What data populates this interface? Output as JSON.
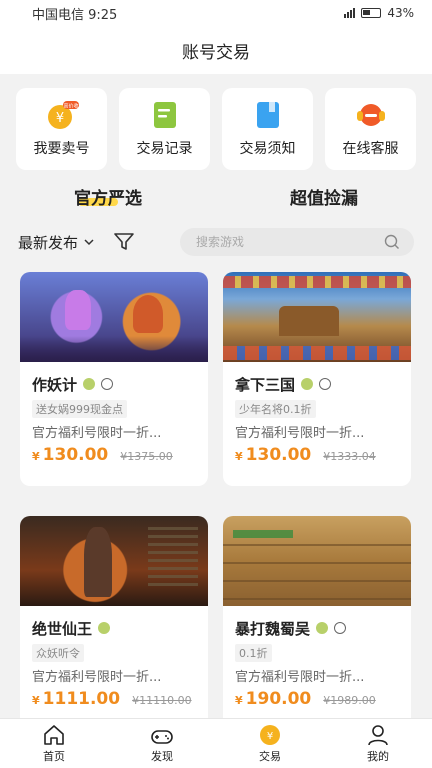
{
  "status": {
    "carrier_time": "中国电信 9:25",
    "battery": "43%"
  },
  "title": "账号交易",
  "quick_actions": [
    {
      "label": "我要卖号",
      "badge": "高价收"
    },
    {
      "label": "交易记录"
    },
    {
      "label": "交易须知"
    },
    {
      "label": "在线客服"
    }
  ],
  "tabs": [
    {
      "label": "官方严选",
      "active": true
    },
    {
      "label": "超值捡漏",
      "active": false
    }
  ],
  "filter": {
    "sort_label": "最新发布",
    "search_placeholder": "搜索游戏"
  },
  "cards": [
    {
      "name": "作妖计",
      "tag": "送女娲999现金点",
      "desc": "官方福利号限时一折...",
      "price": "130.00",
      "original": "¥1375.00",
      "platforms": [
        "android",
        "ios"
      ]
    },
    {
      "name": "拿下三国",
      "tag": "少年名将0.1折",
      "desc": "官方福利号限时一折...",
      "price": "130.00",
      "original": "¥1333.04",
      "platforms": [
        "android",
        "ios"
      ]
    },
    {
      "name": "绝世仙王",
      "tag": "众妖听令",
      "desc": "官方福利号限时一折...",
      "price": "1111.00",
      "original": "¥11110.00",
      "platforms": [
        "android"
      ]
    },
    {
      "name": "暴打魏蜀吴",
      "tag": "0.1折",
      "desc": "官方福利号限时一折...",
      "price": "190.00",
      "original": "¥1989.00",
      "platforms": [
        "android",
        "ios"
      ]
    }
  ],
  "currency": "¥",
  "bottom_nav": [
    {
      "label": "首页",
      "icon": "home-icon"
    },
    {
      "label": "发现",
      "icon": "gamepad-icon"
    },
    {
      "label": "交易",
      "icon": "trade-icon",
      "active": true
    },
    {
      "label": "我的",
      "icon": "user-icon"
    }
  ],
  "colors": {
    "accent": "#f08c1e",
    "tab_highlight": "#ffd84a",
    "background": "#f2f2f2"
  }
}
